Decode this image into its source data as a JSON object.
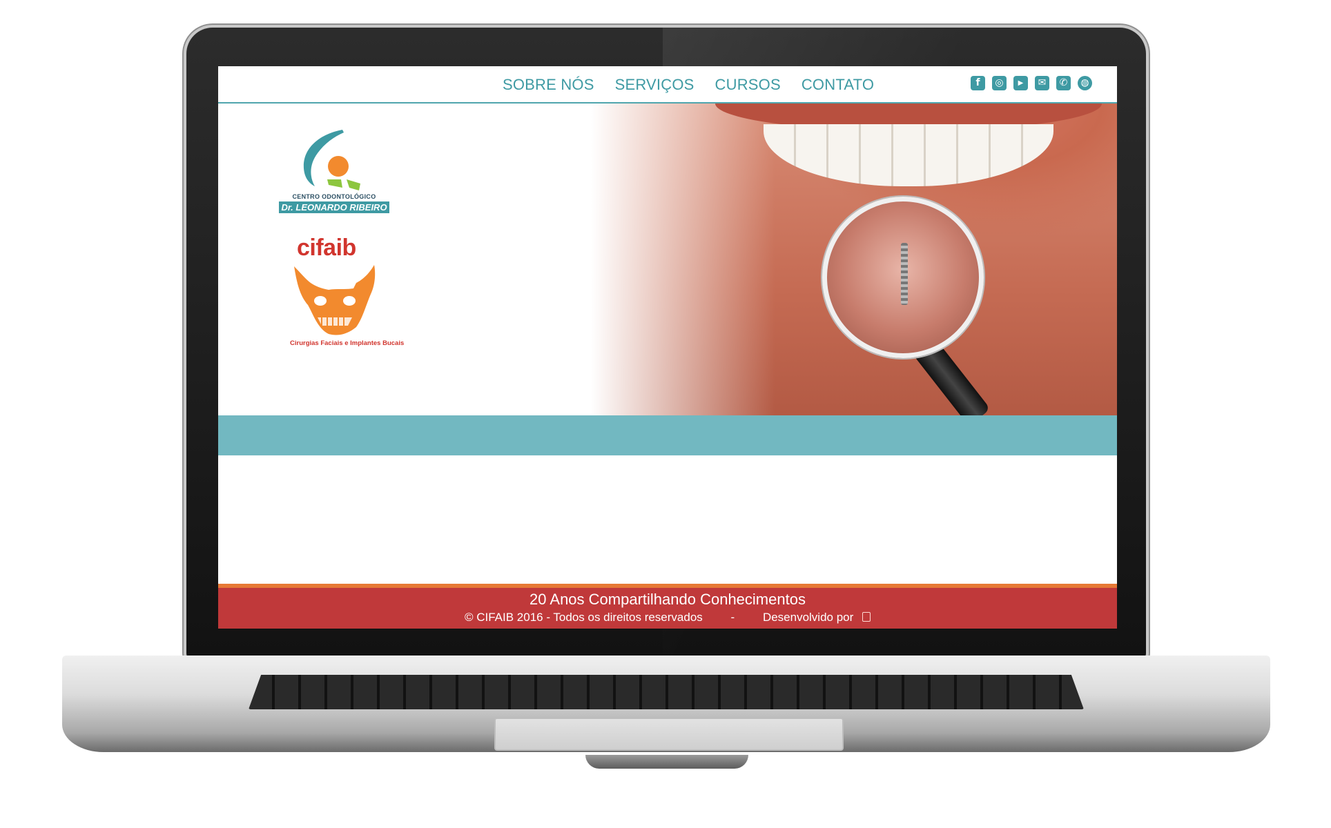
{
  "nav": {
    "items": [
      {
        "label": "SOBRE NÓS"
      },
      {
        "label": "SERVIÇOS"
      },
      {
        "label": "CURSOS"
      },
      {
        "label": "CONTATO"
      }
    ]
  },
  "social": {
    "icons": [
      {
        "name": "facebook-icon",
        "glyph": "f"
      },
      {
        "name": "instagram-icon",
        "glyph": "◎"
      },
      {
        "name": "youtube-icon",
        "glyph": "▶"
      },
      {
        "name": "email-icon",
        "glyph": "✉"
      },
      {
        "name": "phone-icon",
        "glyph": "✆"
      },
      {
        "name": "globe-icon",
        "glyph": "◍"
      }
    ]
  },
  "logos": {
    "centro_line1": "CENTRO ODONTOLÓGICO",
    "centro_line2": "Dr. LEONARDO RIBEIRO",
    "cifaib_word": "cifaib",
    "cifaib_tagline": "Cirurgias Faciais e Implantes Bucais"
  },
  "footer": {
    "slogan": "20 Anos Compartilhando Conhecimentos",
    "copyright": "© CIFAIB 2016 - Todos os direitos reservados",
    "separator": "-",
    "developed_by": "Desenvolvido por"
  },
  "colors": {
    "accent": "#3e9aa3",
    "band": "#72b8c1",
    "footer": "#c0393a",
    "footer_border": "#e77935",
    "brand_red": "#d1352e",
    "brand_orange": "#f28a2e"
  }
}
